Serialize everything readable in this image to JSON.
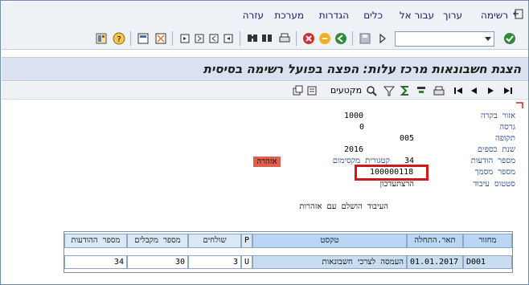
{
  "menu": {
    "items": [
      "רשימה",
      "ערוך",
      "עבור אל",
      "כלים",
      "הגדרות",
      "מערכת",
      "עזרה"
    ]
  },
  "toolbar": {
    "command_value": ""
  },
  "title": "הצגת חשבונאות מרכז עלות: הפצה בפועל רשימה בסיסית",
  "app_toolbar": {
    "segments_label": "מקטעים"
  },
  "fields": [
    {
      "label": "אזור בקרה",
      "value": "1000"
    },
    {
      "label": "גרסה",
      "value": "0"
    },
    {
      "label": "תקופה",
      "value": "005"
    },
    {
      "label": "שנת כספים",
      "value": "2016"
    },
    {
      "label": "מספר הודעות",
      "value": "34"
    },
    {
      "label": "מספר מסמך",
      "value": "100000118"
    },
    {
      "label": "סטטוס עיבוד",
      "value": "הרצתעדכון"
    }
  ],
  "max_category": {
    "label": "קטגורית מקסימום",
    "value": "אזהרה"
  },
  "message": "העיבוד הושלם עם אזהרות",
  "table": {
    "headers": [
      "מחזור",
      "תאר.התחלה",
      "טקסט",
      "P",
      "שולחים",
      "מספר מקבלים",
      "מספר ההודעות"
    ],
    "rows": [
      [
        "D001",
        "01.01.2017",
        "העמסה לצרכי חשבונאות",
        "U",
        "3",
        "30",
        "34"
      ]
    ]
  },
  "colors": {
    "title_bg": "#d9e2ee",
    "warning": "#e06050",
    "highlight": "#d01818",
    "header_bg": "#b9d6f4"
  }
}
